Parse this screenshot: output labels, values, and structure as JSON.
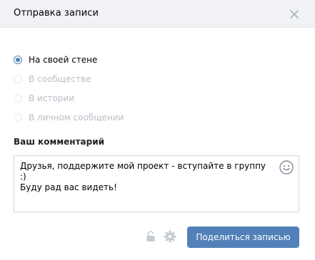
{
  "dialog": {
    "title": "Отправка записи"
  },
  "share_options": [
    {
      "label": "На своей стене",
      "checked": true,
      "enabled": true
    },
    {
      "label": "В сообществе",
      "checked": false,
      "enabled": false
    },
    {
      "label": "В истории",
      "checked": false,
      "enabled": false
    },
    {
      "label": "В личном сообщении",
      "checked": false,
      "enabled": false
    }
  ],
  "comment": {
    "label": "Ваш комментарий",
    "value": "Друзья, поддержите мой проект - вступайте в группу :)\nБуду рад вас видеть!"
  },
  "footer": {
    "share_button_label": "Поделиться записью"
  },
  "colors": {
    "accent": "#5181b8",
    "header_bg": "#f0f2f5",
    "disabled_text": "#b9bec6"
  }
}
